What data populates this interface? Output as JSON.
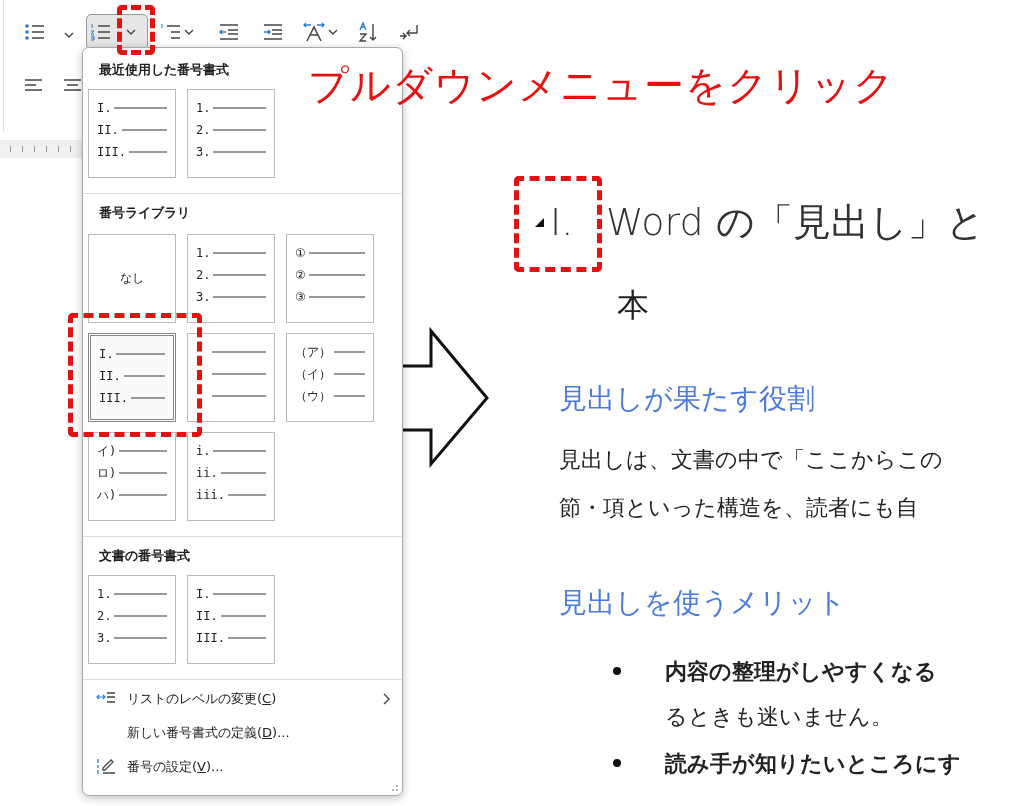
{
  "toolbar": {
    "numbering_button": {
      "pressed": true
    }
  },
  "annotation": {
    "text": "プルダウンメニューをクリック"
  },
  "menu": {
    "sections": [
      {
        "title": "最近使用した番号書式",
        "tiles": [
          {
            "kind": "list",
            "selected": false,
            "markers": [
              "I.",
              "II.",
              "III."
            ]
          },
          {
            "kind": "list",
            "selected": false,
            "markers": [
              "1.",
              "2.",
              "3."
            ]
          }
        ]
      },
      {
        "title": "番号ライブラリ",
        "tiles": [
          {
            "kind": "none",
            "selected": false,
            "label": "なし"
          },
          {
            "kind": "list",
            "selected": false,
            "markers": [
              "1.",
              "2.",
              "3."
            ]
          },
          {
            "kind": "list",
            "selected": false,
            "markers": [
              "①",
              "②",
              "③"
            ]
          },
          {
            "kind": "list",
            "selected": true,
            "markers": [
              "I.",
              "II.",
              "III."
            ]
          },
          {
            "kind": "lines",
            "selected": false
          },
          {
            "kind": "list",
            "selected": false,
            "markers": [
              "（ア）",
              "（イ）",
              "（ウ）"
            ]
          },
          {
            "kind": "list",
            "selected": false,
            "markers": [
              "イ)",
              "ロ)",
              "ハ)"
            ]
          },
          {
            "kind": "list",
            "selected": false,
            "markers": [
              "i.",
              "ii.",
              "iii."
            ]
          }
        ]
      },
      {
        "title": "文書の番号書式",
        "tiles": [
          {
            "kind": "list",
            "selected": false,
            "markers": [
              "1.",
              "2.",
              "3."
            ]
          },
          {
            "kind": "list",
            "selected": false,
            "markers": [
              "I.",
              "II.",
              "III."
            ]
          }
        ]
      }
    ],
    "commands": [
      {
        "before": "リストのレベルの変更(",
        "key": "C",
        "after": ")",
        "submenu": true
      },
      {
        "before": "新しい番号書式の定義(",
        "key": "D",
        "after": ")...",
        "submenu": false
      },
      {
        "before": "番号の設定(",
        "key": "V",
        "after": ")...",
        "submenu": false
      }
    ]
  },
  "document": {
    "heading": {
      "number": "I.",
      "text": "Word の「見出し」と"
    },
    "blocks": [
      {
        "kind": "body",
        "text": "本"
      },
      {
        "kind": "subheading",
        "text": "見出しが果たす役割"
      },
      {
        "kind": "paragraph",
        "lines": [
          "見出しは、文書の中で「ここからこの",
          "節・項といった構造を、読者にも自"
        ]
      },
      {
        "kind": "subheading",
        "text": "見出しを使うメリット"
      },
      {
        "kind": "bullet",
        "lines": [
          {
            "text": "内容の整理がしやすくなる",
            "bold": true
          },
          {
            "text": "るときも迷いません。",
            "bold": false
          }
        ]
      },
      {
        "kind": "bullet",
        "lines": [
          {
            "text": "読み手が知りたいところにす",
            "bold": true
          }
        ]
      }
    ]
  }
}
